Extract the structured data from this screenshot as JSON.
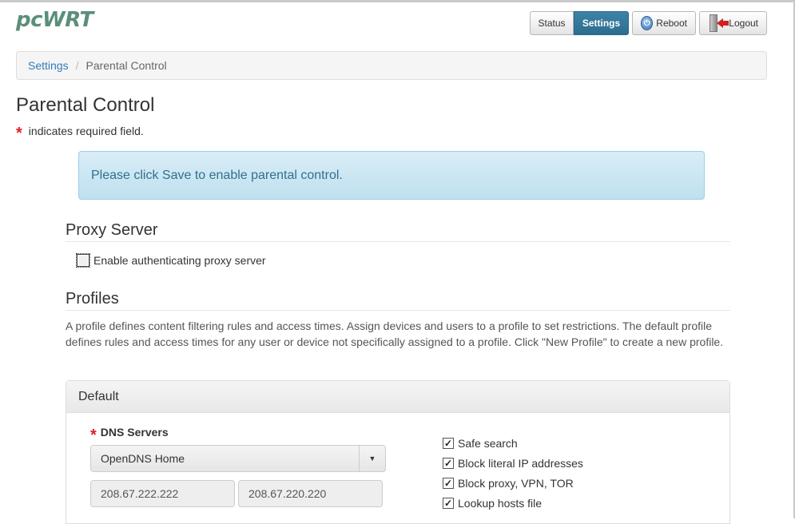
{
  "header": {
    "logo": "pcWRT",
    "nav": {
      "status_label": "Status",
      "settings_label": "Settings"
    },
    "reboot_label": "Reboot",
    "logout_label": "Logout"
  },
  "breadcrumb": {
    "parent": "Settings",
    "separator": "/",
    "current": "Parental Control"
  },
  "page": {
    "title": "Parental Control",
    "required_asterisk": "*",
    "required_note": "indicates required field."
  },
  "alert": {
    "text": "Please click Save to enable parental control."
  },
  "proxy": {
    "title": "Proxy Server",
    "checkbox_label": "Enable authenticating proxy server",
    "checked": false
  },
  "profiles": {
    "title": "Profiles",
    "description": "A profile defines content filtering rules and access times. Assign devices and users to a profile to set restrictions. The default profile defines rules and access times for any user or device not specifically assigned to a profile. Click \"New Profile\" to create a new profile.",
    "default_panel": {
      "heading": "Default",
      "dns_label": "DNS Servers",
      "dns_selected": "OpenDNS Home",
      "dns_primary": "208.67.222.222",
      "dns_secondary": "208.67.220.220",
      "options": [
        {
          "label": "Safe search",
          "checked": true
        },
        {
          "label": "Block literal IP addresses",
          "checked": true
        },
        {
          "label": "Block proxy, VPN, TOR",
          "checked": true
        },
        {
          "label": "Lookup hosts file",
          "checked": true
        }
      ]
    }
  },
  "colors": {
    "accent": "#337ab7",
    "settings_active": "#2c6d8f",
    "alert_bg": "#d9edf7",
    "alert_text": "#31708f",
    "required": "#e02020",
    "logo": "#5b8f7a"
  },
  "icons": {
    "reboot": "power-icon",
    "logout": "logout-door-icon",
    "select_caret": "caret-down-icon",
    "check": "check-icon"
  }
}
